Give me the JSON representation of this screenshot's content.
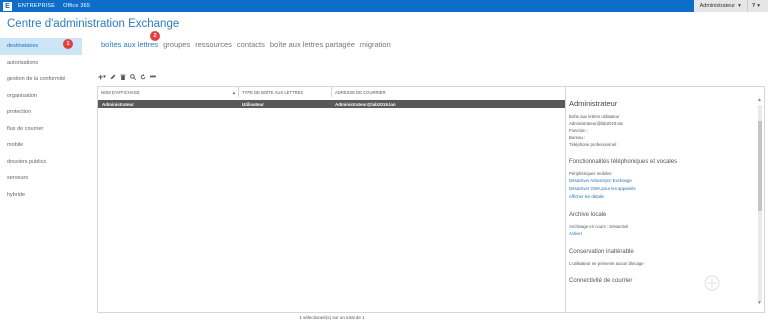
{
  "topbar": {
    "logo_glyph": "E",
    "brand": "ENTREPRISE",
    "product": "Office 365",
    "user": "Administrateur",
    "help": "?"
  },
  "app_title": "Centre d'administration Exchange",
  "sidebar": {
    "items": [
      {
        "label": "destinataires",
        "active": true
      },
      {
        "label": "autorisations"
      },
      {
        "label": "gestion de la conformité"
      },
      {
        "label": "organisation"
      },
      {
        "label": "protection"
      },
      {
        "label": "flux de courrier"
      },
      {
        "label": "mobile"
      },
      {
        "label": "dossiers publics"
      },
      {
        "label": "serveurs"
      },
      {
        "label": "hybride"
      }
    ]
  },
  "badges": {
    "b1": "1",
    "b2": "2"
  },
  "tabs": [
    {
      "label": "boîtes aux lettres",
      "active": true
    },
    {
      "label": "groupes"
    },
    {
      "label": "ressources"
    },
    {
      "label": "contacts"
    },
    {
      "label": "boîte aux lettres partagée"
    },
    {
      "label": "migration"
    }
  ],
  "toolbar": {
    "add_icon": "plus-icon",
    "edit_icon": "pencil-icon",
    "delete_icon": "trash-icon",
    "search_icon": "search-icon",
    "refresh_icon": "refresh-icon",
    "more_icon": "more-icon"
  },
  "grid": {
    "columns": [
      "NOM D'AFFICHAGE",
      "TYPE DE BOÎTE AUX LETTRES",
      "ADRESSE DE COURRIER"
    ],
    "rows": [
      [
        "Administrateur",
        "Utilisateur",
        "Administrateur@lab2019.lan"
      ]
    ]
  },
  "details": {
    "title": "Administrateur",
    "lines1": [
      "Boîte aux lettres utilisateur",
      "Administrateur@lab2019.lan",
      "Fonction :",
      "Bureau :",
      "Téléphone professionnel :"
    ],
    "section_phone": "Fonctionnalités téléphoniques et vocales",
    "phone_lines": [
      "Périphériques mobiles"
    ],
    "phone_links": [
      "Désactiver ActiveSync Exchange",
      "Désactiver OWA pour les appareils",
      "Afficher les détails"
    ],
    "section_archive": "Archive locale",
    "archive_line": "Archivage en cours : Désactivé",
    "archive_link": "Activer",
    "section_hold": "Conservation inaltérable",
    "hold_line": "L'utilisateur ne présente aucun blocage",
    "section_conn": "Connectivité de courrier"
  },
  "status": "1 sélectionné(s) sur un total de 1",
  "colors": {
    "accent": "#0e6dc9",
    "selected_row": "#595959",
    "badge": "#e0423f",
    "active_sidebar": "#cde6f7"
  }
}
